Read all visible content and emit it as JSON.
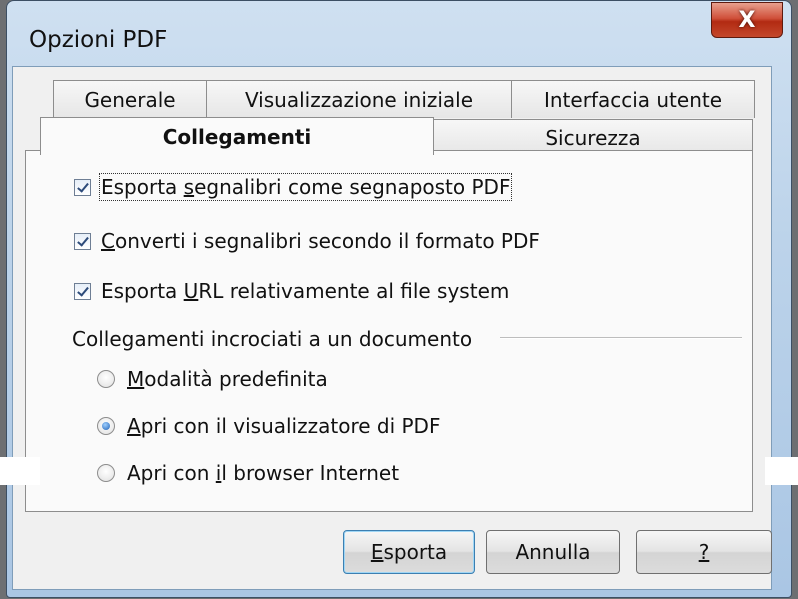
{
  "window": {
    "title": "Opzioni PDF",
    "close_glyph": "X"
  },
  "tabs_row1": [
    {
      "label": "Generale"
    },
    {
      "label": "Visualizzazione iniziale"
    },
    {
      "label": "Interfaccia utente"
    }
  ],
  "tabs_row2": [
    {
      "label": "Collegamenti",
      "active": true
    },
    {
      "label": "Sicurezza",
      "active": false
    }
  ],
  "options": {
    "export_bookmarks": {
      "pre": "Esporta ",
      "mn": "s",
      "post": "egnalibri come segnaposto PDF",
      "checked": true
    },
    "convert_bookmarks": {
      "pre": "",
      "mn": "C",
      "post": "onverti i segnalibri secondo il formato PDF",
      "checked": true
    },
    "relative_urls": {
      "pre": "Esporta ",
      "mn": "U",
      "post": "RL relativamente al file system",
      "checked": true
    }
  },
  "cross_links": {
    "label": "Collegamenti incrociati a un documento",
    "radios": [
      {
        "pre": "",
        "mn": "M",
        "post": "odalità predefinita",
        "checked": false
      },
      {
        "pre": "",
        "mn": "A",
        "post": "pri con il visualizzatore di PDF",
        "checked": true
      },
      {
        "pre": "Apri con ",
        "mn": "i",
        "post": "l browser Internet",
        "checked": false
      }
    ]
  },
  "buttons": {
    "export": {
      "mn": "E",
      "post": "sporta"
    },
    "cancel": {
      "label": "Annulla"
    },
    "help": {
      "mn": "?"
    }
  },
  "icons": {
    "close": "close-icon",
    "checkbox": "checkbox-checked-icon",
    "radio": "radio-icon"
  }
}
